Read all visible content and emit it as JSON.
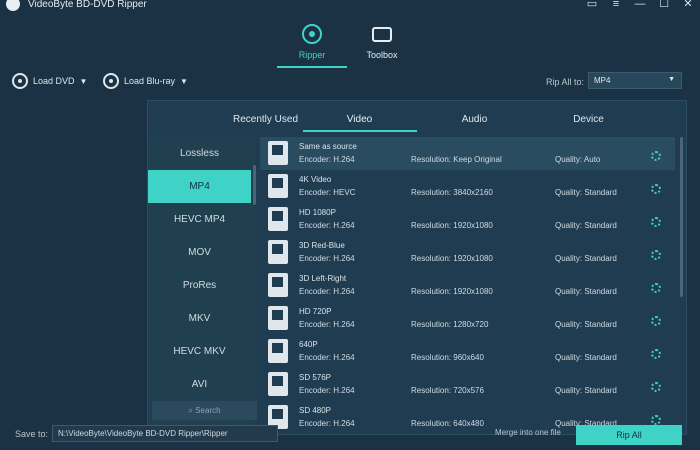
{
  "app": {
    "title": "VideoByte BD-DVD Ripper"
  },
  "nav": {
    "ripper": "Ripper",
    "toolbox": "Toolbox"
  },
  "toolbar": {
    "load_dvd": "Load DVD",
    "load_bluray": "Load Blu-ray",
    "rip_all_label": "Rip All to:",
    "rip_all_value": "MP4"
  },
  "tabs": [
    "Recently Used",
    "Video",
    "Audio",
    "Device"
  ],
  "sidebar": {
    "items": [
      "Lossless",
      "MP4",
      "HEVC MP4",
      "MOV",
      "ProRes",
      "MKV",
      "HEVC MKV",
      "AVI"
    ],
    "search": "Search"
  },
  "formats": [
    {
      "name": "Same as source",
      "encoder": "Encoder: H.264",
      "resolution": "Resolution: Keep Original",
      "quality": "Quality: Auto"
    },
    {
      "name": "4K Video",
      "encoder": "Encoder: HEVC",
      "resolution": "Resolution: 3840x2160",
      "quality": "Quality: Standard"
    },
    {
      "name": "HD 1080P",
      "encoder": "Encoder: H.264",
      "resolution": "Resolution: 1920x1080",
      "quality": "Quality: Standard"
    },
    {
      "name": "3D Red-Blue",
      "encoder": "Encoder: H.264",
      "resolution": "Resolution: 1920x1080",
      "quality": "Quality: Standard"
    },
    {
      "name": "3D Left-Right",
      "encoder": "Encoder: H.264",
      "resolution": "Resolution: 1920x1080",
      "quality": "Quality: Standard"
    },
    {
      "name": "HD 720P",
      "encoder": "Encoder: H.264",
      "resolution": "Resolution: 1280x720",
      "quality": "Quality: Standard"
    },
    {
      "name": "640P",
      "encoder": "Encoder: H.264",
      "resolution": "Resolution: 960x640",
      "quality": "Quality: Standard"
    },
    {
      "name": "SD 576P",
      "encoder": "Encoder: H.264",
      "resolution": "Resolution: 720x576",
      "quality": "Quality: Standard"
    },
    {
      "name": "SD 480P",
      "encoder": "Encoder: H.264",
      "resolution": "Resolution: 640x480",
      "quality": "Quality: Standard"
    }
  ],
  "bottom": {
    "save_label": "Save to:",
    "save_path": "N:\\VideoByte\\VideoByte BD-DVD Ripper\\Ripper",
    "merge": "Merge into one file",
    "rip_all": "Rip All"
  }
}
